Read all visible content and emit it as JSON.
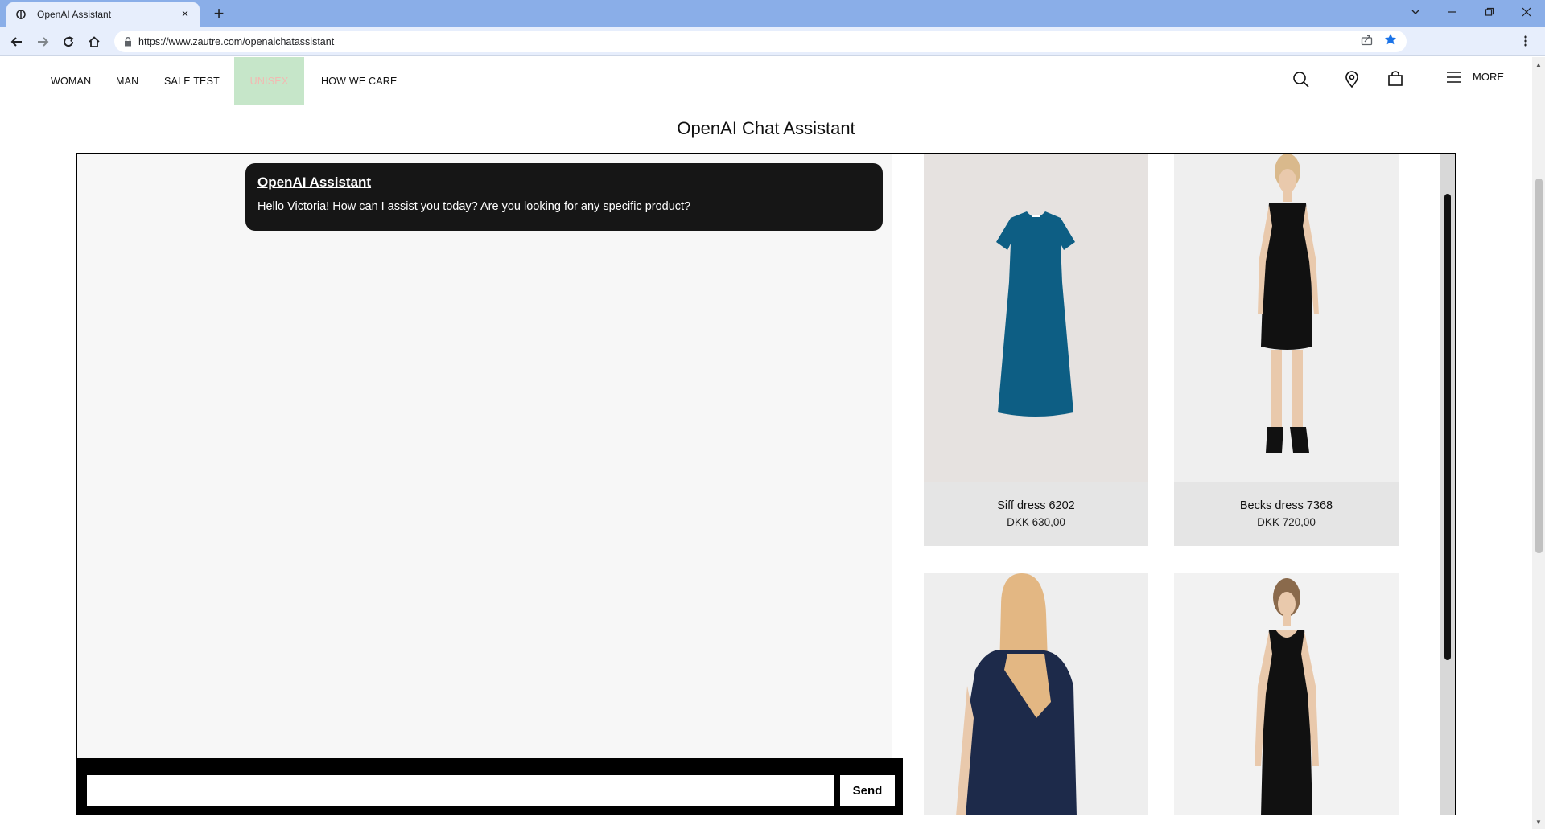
{
  "browser": {
    "tab_title": "OpenAI Assistant",
    "tab_close": "×",
    "new_tab": "+",
    "url": "https://www.zautre.com/openaichatassistant"
  },
  "site": {
    "nav": [
      {
        "label": "WOMAN"
      },
      {
        "label": "MAN"
      },
      {
        "label": "SALE TEST"
      },
      {
        "label": "UNISEX"
      },
      {
        "label": "HOW WE CARE"
      }
    ],
    "more_label": "MORE"
  },
  "page": {
    "title": "OpenAI Chat Assistant"
  },
  "chat": {
    "messages": [
      {
        "sender": "OpenAI Assistant",
        "text": "Hello Victoria! How can I assist you today? Are you looking for any specific product?"
      }
    ],
    "input_value": "",
    "input_placeholder": "",
    "send_label": "Send"
  },
  "products": [
    {
      "name": "Siff dress 6202",
      "price": "DKK 630,00",
      "color": "#0d5e84"
    },
    {
      "name": "Becks dress 7368",
      "price": "DKK 720,00",
      "color": "#111111"
    },
    {
      "name": "",
      "price": "",
      "color": "#1d2a4a"
    },
    {
      "name": "",
      "price": "",
      "color": "#111111"
    }
  ],
  "colors": {
    "tabbar": "#8aaee8",
    "toolbar": "#e7eefc",
    "highlight_bg": "#c6e6c9",
    "highlight_text": "#f2b9b2",
    "message_bg": "#161616"
  }
}
